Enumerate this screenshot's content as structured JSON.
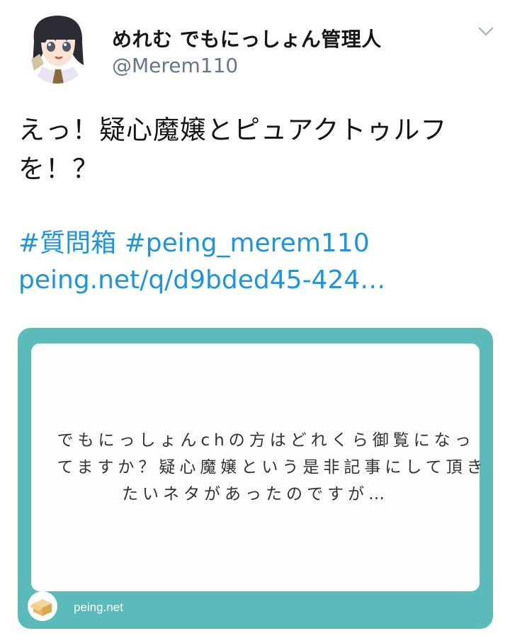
{
  "author": {
    "display_name": "めれむ でもにっしょん管理人",
    "handle": "@Merem110"
  },
  "tweet": {
    "text": "えっ！疑心魔嬢とピュアクトゥルフを！？",
    "hashtags": [
      "#質問箱",
      "#peing_merem110"
    ],
    "link": "peing.net/q/d9bded45-424…"
  },
  "card": {
    "question_lines": [
      "でもにっしょんchの方はどれくら御覧になっ",
      "てますか？疑心魔嬢という是非記事にして頂き",
      "たいネタがあったのですが…"
    ],
    "site_name": "peing.net"
  },
  "colors": {
    "link": "#1b95e0",
    "card_bg": "#5bbbbb",
    "handle": "#657786"
  },
  "icons": [
    "avatar-image",
    "chevron-down-icon",
    "peing-box-icon"
  ]
}
